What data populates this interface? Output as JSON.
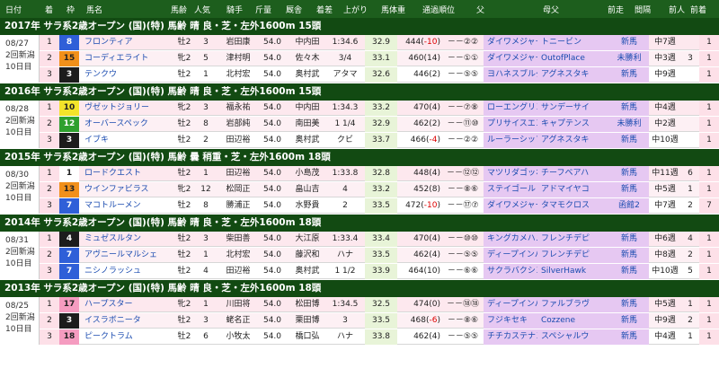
{
  "header": [
    "日付",
    "着",
    "枠",
    "馬名",
    "馬齢",
    "人気",
    "騎手",
    "斤量",
    "厩舎",
    "着差",
    "上がり",
    "馬体重",
    "通過順位",
    "父",
    "母父",
    "前走",
    "間隔",
    "前人",
    "前着"
  ],
  "years": [
    {
      "title": "2017年 サラ系2歳オープン (国)(特) 馬齢 晴 良・芝・左外1600m 15頭",
      "date": [
        "08/27",
        "2回新潟",
        "10日目"
      ],
      "rows": [
        {
          "rank": "1",
          "waku": "8",
          "num": "",
          "name": "フロンティア",
          "sex": "牡2",
          "pop": "3",
          "jockey": "岩田康",
          "kin": "54.0",
          "stable": "中内田",
          "margin": "1:34.6",
          "agari": "32.9",
          "bw": "444(-10)",
          "pass": "－－②②",
          "sire": "ダイワメジャー",
          "bms": "トニービン",
          "prev": "新馬",
          "gap": "中7週",
          "pp": "",
          "pr": "1"
        },
        {
          "rank": "2",
          "waku": "15",
          "num": "",
          "name": "コーディエライト",
          "sex": "牝2",
          "pop": "5",
          "jockey": "津村明",
          "kin": "54.0",
          "stable": "佐々木",
          "margin": "3/4",
          "agari": "33.1",
          "bw": "460(14)",
          "pass": "－－①①",
          "sire": "ダイワメジャー",
          "bms": "OutofPlace",
          "prev": "未勝利",
          "gap": "中3週",
          "pp": "3",
          "pr": "1"
        },
        {
          "rank": "3",
          "waku": "3",
          "num": "",
          "name": "テンクウ",
          "sex": "牡2",
          "pop": "1",
          "jockey": "北村宏",
          "kin": "54.0",
          "stable": "奥村武",
          "margin": "アタマ",
          "agari": "32.6",
          "bw": "446(2)",
          "pass": "－－⑤⑤",
          "sire": "ヨハネスブルグ",
          "bms": "アグネスタキ",
          "prev": "新馬",
          "gap": "中9週",
          "pp": "",
          "pr": "1"
        }
      ]
    },
    {
      "title": "2016年 サラ系2歳オープン (国)(特) 馬齢 晴 良・芝・左外1600m 15頭",
      "date": [
        "08/28",
        "2回新潟",
        "10日目"
      ],
      "rows": [
        {
          "rank": "1",
          "waku": "10",
          "num": "",
          "name": "ヴゼットジョリー",
          "sex": "牝2",
          "pop": "3",
          "jockey": "福永祐",
          "kin": "54.0",
          "stable": "中内田",
          "margin": "1:34.3",
          "agari": "33.2",
          "bw": "470(4)",
          "pass": "－－⑦⑧",
          "sire": "ローエングリン",
          "bms": "サンデーサイ",
          "prev": "新馬",
          "gap": "中4週",
          "pp": "",
          "pr": "1"
        },
        {
          "rank": "2",
          "waku": "12",
          "num": "",
          "name": "オーバースペック",
          "sex": "牡2",
          "pop": "8",
          "jockey": "岩部純",
          "kin": "54.0",
          "stable": "南田美",
          "margin": "1 1/4",
          "agari": "32.9",
          "bw": "462(2)",
          "pass": "－－⑪⑩",
          "sire": "プリサイスエンド",
          "bms": "キャプテンス",
          "prev": "未勝利",
          "gap": "中2週",
          "pp": "",
          "pr": "1"
        },
        {
          "rank": "3",
          "waku": "3",
          "num": "",
          "name": "イブキ",
          "sex": "牡2",
          "pop": "2",
          "jockey": "田辺裕",
          "kin": "54.0",
          "stable": "奥村武",
          "margin": "クビ",
          "agari": "33.7",
          "bw": "466(-4)",
          "pass": "－－②②",
          "sire": "ルーラーシップ",
          "bms": "アグネスタキ",
          "prev": "新馬",
          "gap": "中10週",
          "pp": "",
          "pr": "1"
        }
      ]
    },
    {
      "title": "2015年 サラ系2歳オープン (国)(特) 馬齢 曇 稍重・芝・左外1600m 18頭",
      "date": [
        "08/30",
        "2回新潟",
        "10日目"
      ],
      "rows": [
        {
          "rank": "1",
          "waku": "1",
          "num": "",
          "name": "ロードクエスト",
          "sex": "牡2",
          "pop": "1",
          "jockey": "田辺裕",
          "kin": "54.0",
          "stable": "小島茂",
          "margin": "1:33.8",
          "agari": "32.8",
          "bw": "448(4)",
          "pass": "－－⑫⑫",
          "sire": "マツリダゴッホ",
          "bms": "チーフベアハ",
          "prev": "新馬",
          "gap": "中11週",
          "pp": "6",
          "pr": "1"
        },
        {
          "rank": "2",
          "waku": "13",
          "num": "",
          "name": "ウインファビラス",
          "sex": "牝2",
          "pop": "12",
          "jockey": "松岡正",
          "kin": "54.0",
          "stable": "畠山吉",
          "margin": "4",
          "agari": "33.2",
          "bw": "452(8)",
          "pass": "－－⑧⑥",
          "sire": "ステイゴールド",
          "bms": "アドマイヤコ",
          "prev": "新馬",
          "gap": "中5週",
          "pp": "1",
          "pr": "1"
        },
        {
          "rank": "3",
          "waku": "7",
          "num": "",
          "name": "マコトルーメン",
          "sex": "牡2",
          "pop": "8",
          "jockey": "勝浦正",
          "kin": "54.0",
          "stable": "水野貴",
          "margin": "2",
          "agari": "33.5",
          "bw": "472(-10)",
          "pass": "－－⑰⑦",
          "sire": "ダイワメジャー",
          "bms": "タマモクロス",
          "prev": "函館2",
          "gap": "中7週",
          "pp": "2",
          "pr": "7"
        }
      ]
    },
    {
      "title": "2014年 サラ系2歳オープン (国)(特) 馬齢 晴 良・芝・左外1600m 18頭",
      "date": [
        "08/31",
        "2回新潟",
        "10日目"
      ],
      "rows": [
        {
          "rank": "1",
          "waku": "4",
          "num": "",
          "name": "ミュゼスルタン",
          "sex": "牡2",
          "pop": "3",
          "jockey": "柴田善",
          "kin": "54.0",
          "stable": "大江原",
          "margin": "1:33.4",
          "agari": "33.4",
          "bw": "470(4)",
          "pass": "－－⑩⑩",
          "sire": "キングカメハメハ",
          "bms": "フレンチデピ",
          "prev": "新馬",
          "gap": "中6週",
          "pp": "4",
          "pr": "1"
        },
        {
          "rank": "2",
          "waku": "7",
          "num": "",
          "name": "アヴニールマルシェ",
          "sex": "牡2",
          "pop": "1",
          "jockey": "北村宏",
          "kin": "54.0",
          "stable": "藤沢和",
          "margin": "ハナ",
          "agari": "33.5",
          "bw": "462(4)",
          "pass": "－－⑤⑤",
          "sire": "ディープインパクト",
          "bms": "フレンチデピ",
          "prev": "新馬",
          "gap": "中8週",
          "pp": "2",
          "pr": "1"
        },
        {
          "rank": "3",
          "waku": "7",
          "num": "",
          "name": "ニシノラッシュ",
          "sex": "牡2",
          "pop": "4",
          "jockey": "田辺裕",
          "kin": "54.0",
          "stable": "奥村武",
          "margin": "1 1/2",
          "agari": "33.9",
          "bw": "464(10)",
          "pass": "－－⑥⑥",
          "sire": "サクラバクシンオー",
          "bms": "SilverHawk",
          "prev": "新馬",
          "gap": "中10週",
          "pp": "5",
          "pr": "1"
        }
      ]
    },
    {
      "title": "2013年 サラ系2歳オープン (国)(特) 馬齢 晴 良・芝・左外1600m 18頭",
      "date": [
        "08/25",
        "2回新潟",
        "10日目"
      ],
      "rows": [
        {
          "rank": "1",
          "waku": "17",
          "num": "",
          "name": "ハープスター",
          "sex": "牝2",
          "pop": "1",
          "jockey": "川田将",
          "kin": "54.0",
          "stable": "松田博",
          "margin": "1:34.5",
          "agari": "32.5",
          "bw": "474(0)",
          "pass": "－－⑱⑱",
          "sire": "ディープインパクト",
          "bms": "ファルブラヴ",
          "prev": "新馬",
          "gap": "中5週",
          "pp": "1",
          "pr": "1"
        },
        {
          "rank": "2",
          "waku": "3",
          "num": "",
          "name": "イスラボニータ",
          "sex": "牡2",
          "pop": "3",
          "jockey": "蛯名正",
          "kin": "54.0",
          "stable": "栗田博",
          "margin": "3",
          "agari": "33.5",
          "bw": "468(-6)",
          "pass": "－－⑧⑥",
          "sire": "フジキセキ",
          "bms": "Cozzene",
          "prev": "新馬",
          "gap": "中9週",
          "pp": "2",
          "pr": "1"
        },
        {
          "rank": "3",
          "waku": "18",
          "num": "",
          "name": "ピークトラム",
          "sex": "牡2",
          "pop": "6",
          "jockey": "小牧太",
          "kin": "54.0",
          "stable": "橋口弘",
          "margin": "ハナ",
          "agari": "33.8",
          "bw": "462(4)",
          "pass": "－－⑤⑤",
          "sire": "チチカステナンゴ",
          "bms": "スペシャルウ",
          "prev": "新馬",
          "gap": "中4週",
          "pp": "1",
          "pr": "1"
        }
      ]
    }
  ],
  "colors": {
    "header": "#1d5e1d",
    "yearbar": "#124a12",
    "waku": {
      "1": "#ffffff",
      "2": "#222222",
      "3": "#e02020",
      "4": "#2456d8",
      "5": "#f2e21a",
      "6": "#2ea02e",
      "7": "#f28a1a",
      "8": "#f08ab4"
    }
  }
}
